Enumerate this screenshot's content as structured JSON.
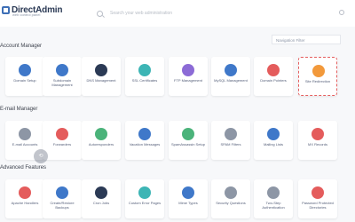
{
  "header": {
    "logo_text": "DirectAdmin",
    "logo_subtext": "web control panel",
    "search_placeholder": "Search your web administration"
  },
  "nav_filter_label": "Navigation Filter",
  "sections": [
    {
      "title": "Account Manager",
      "cards": [
        {
          "label": "Domain Setup",
          "icon": "globe-icon",
          "color": "#3f78c9"
        },
        {
          "label": "Subdomain Management",
          "icon": "subdomain-icon",
          "color": "#3f78c9"
        },
        {
          "label": "DNS Management",
          "icon": "dns-icon",
          "color": "#2b3a55"
        },
        {
          "label": "SSL Certificates",
          "icon": "ssl-icon",
          "color": "#3db5b5"
        },
        {
          "label": "FTP Management",
          "icon": "ftp-icon",
          "color": "#8c6bd6"
        },
        {
          "label": "MySQL Management",
          "icon": "database-icon",
          "color": "#3f78c9"
        },
        {
          "label": "Domain Pointers",
          "icon": "pointer-icon",
          "color": "#e45c5c"
        },
        {
          "label": "Site Redirection",
          "icon": "signpost-icon",
          "color": "#f2993b"
        }
      ]
    },
    {
      "title": "E-mail Manager",
      "cards": [
        {
          "label": "E-mail Accounts",
          "icon": "email-icon",
          "color": "#8d96a5"
        },
        {
          "label": "Forwarders",
          "icon": "forward-icon",
          "color": "#e45c5c"
        },
        {
          "label": "Autoresponders",
          "icon": "autoresponder-icon",
          "color": "#4bb37a"
        },
        {
          "label": "Vacation Messages",
          "icon": "vacation-icon",
          "color": "#3f78c9"
        },
        {
          "label": "SpamAssassin Setup",
          "icon": "spam-icon",
          "color": "#4bb37a"
        },
        {
          "label": "SPAM Filters",
          "icon": "filter-icon",
          "color": "#8d96a5"
        },
        {
          "label": "Mailing Lists",
          "icon": "list-icon",
          "color": "#3f78c9"
        },
        {
          "label": "MX Records",
          "icon": "mx-icon",
          "color": "#e45c5c"
        }
      ]
    },
    {
      "title": "Advanced Features",
      "cards": [
        {
          "label": "Apache Handlers",
          "icon": "handler-icon",
          "color": "#e45c5c"
        },
        {
          "label": "Create/Restore Backups",
          "icon": "backup-icon",
          "color": "#3f78c9"
        },
        {
          "label": "Cron Jobs",
          "icon": "cron-icon",
          "color": "#2b3a55"
        },
        {
          "label": "Custom Error Pages",
          "icon": "error-page-icon",
          "color": "#3db5b5"
        },
        {
          "label": "Mime Types",
          "icon": "mime-icon",
          "color": "#3f78c9"
        },
        {
          "label": "Security Questions",
          "icon": "shield-icon",
          "color": "#8d96a5"
        },
        {
          "label": "Two-Step Authentication",
          "icon": "lock-icon",
          "color": "#8d96a5"
        },
        {
          "label": "Password Protected Directories",
          "icon": "folder-lock-icon",
          "color": "#e45c5c"
        }
      ]
    }
  ]
}
